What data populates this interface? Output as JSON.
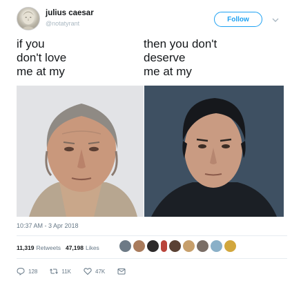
{
  "tweet": {
    "display_name": "julius caesar",
    "handle": "@notatyrant",
    "follow_label": "Follow",
    "caption_left": [
      "if you",
      "don't love",
      "me at my"
    ],
    "caption_right": [
      "then you don't",
      "deserve",
      "me at my"
    ],
    "timestamp": "10:37 AM - 3 Apr 2018",
    "retweets_count": "11,319",
    "retweets_label": "Retweets",
    "likes_count": "47,198",
    "likes_label": "Likes",
    "reply_count": "128",
    "retweet_action_count": "11K",
    "like_action_count": "47K"
  },
  "colors": {
    "accent": "#1da1f2",
    "muted": "#657786"
  },
  "icons": [
    "avatar",
    "chevron-down-icon",
    "reply-icon",
    "retweet-icon",
    "like-icon",
    "message-icon"
  ]
}
